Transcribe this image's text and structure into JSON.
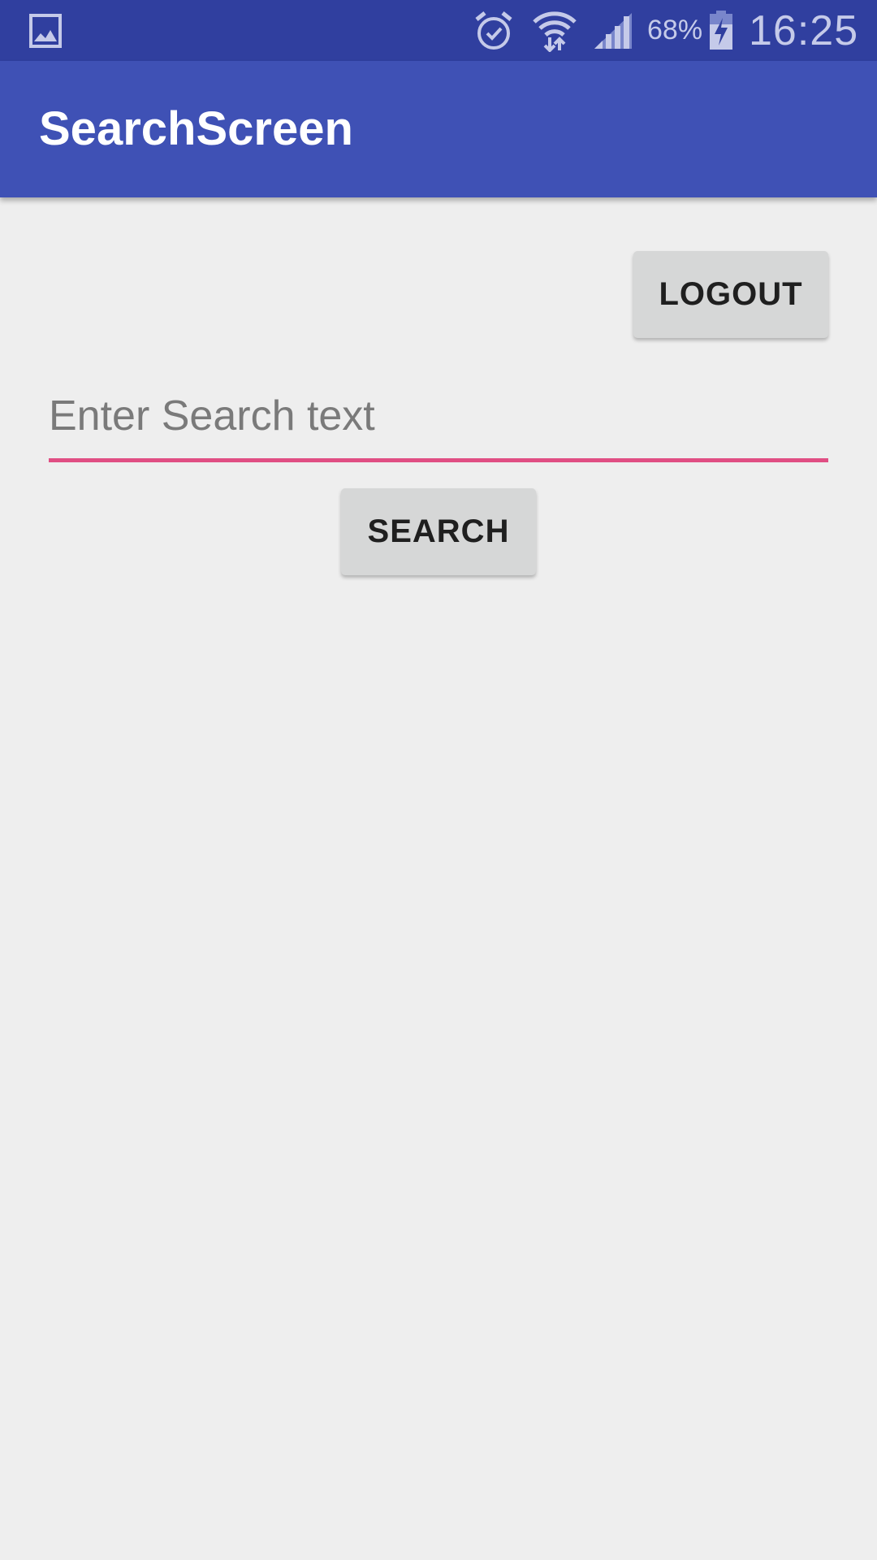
{
  "status_bar": {
    "left_icon": "gallery-notification-icon",
    "alarm_icon": "alarm-icon",
    "wifi_icon": "wifi-icon",
    "signal_icon": "cell-signal-icon",
    "battery_percent": "68%",
    "battery_icon": "battery-charging-icon",
    "time": "16:25"
  },
  "toolbar": {
    "title": "SearchScreen"
  },
  "main": {
    "logout_label": "LOGOUT",
    "search_placeholder": "Enter Search text",
    "search_value": "",
    "search_label": "SEARCH"
  },
  "colors": {
    "status_bar": "#303F9F",
    "toolbar": "#3F51B5",
    "accent": "#E04E83",
    "background": "#EEEEEE",
    "button": "#D6D7D7"
  }
}
